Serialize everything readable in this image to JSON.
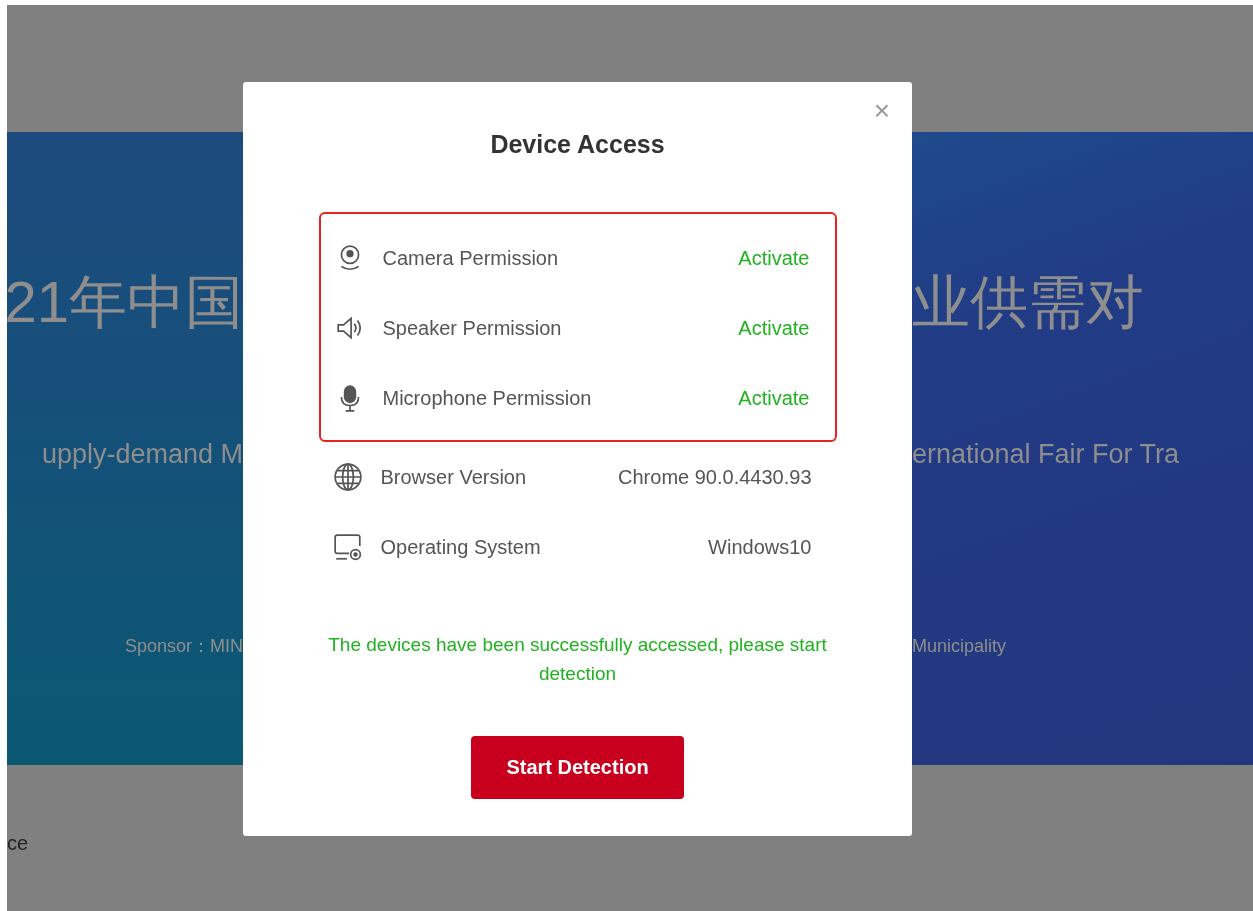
{
  "background": {
    "left": {
      "headline": "21年中国",
      "subtitle": "upply-demand M",
      "sponsor": "Sponsor：MIN",
      "footer": "ce"
    },
    "right": {
      "headline": "业供需对",
      "subtitle": "ernational Fair For Tra",
      "sponsor": "Municipality"
    }
  },
  "dialog": {
    "title": "Device Access",
    "close": "×",
    "permissions": [
      {
        "label": "Camera Permission",
        "status": "Activate"
      },
      {
        "label": "Speaker Permission",
        "status": "Activate"
      },
      {
        "label": "Microphone Permission",
        "status": "Activate"
      }
    ],
    "system_info": [
      {
        "label": "Browser Version",
        "value": "Chrome 90.0.4430.93"
      },
      {
        "label": "Operating System",
        "value": "Windows10"
      }
    ],
    "message": "The devices have been successfully accessed, please start detection",
    "button": "Start Detection"
  }
}
